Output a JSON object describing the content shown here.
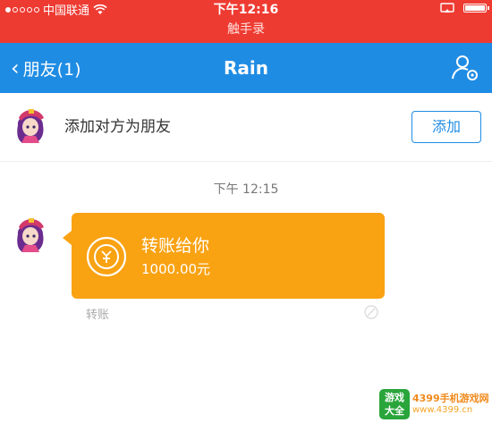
{
  "status_bar": {
    "carrier": "中国联通",
    "time": "下午12:16",
    "recording_label": "触手录",
    "color": "#ee3b32"
  },
  "nav": {
    "back_label": "朋友(1)",
    "title": "Rain",
    "color": "#1f8ce4"
  },
  "add_friend": {
    "prompt": "添加对方为朋友",
    "button_label": "添加"
  },
  "chat": {
    "timestamp": "下午 12:15",
    "message": {
      "title": "转账给你",
      "amount": "1000.00元",
      "footer": "转账",
      "bubble_color": "#f9a212"
    }
  },
  "watermark": {
    "logo_top": "游戏",
    "logo_bottom": "大全",
    "site_name": "4399手机游戏网",
    "url": "www.4399.cn"
  }
}
